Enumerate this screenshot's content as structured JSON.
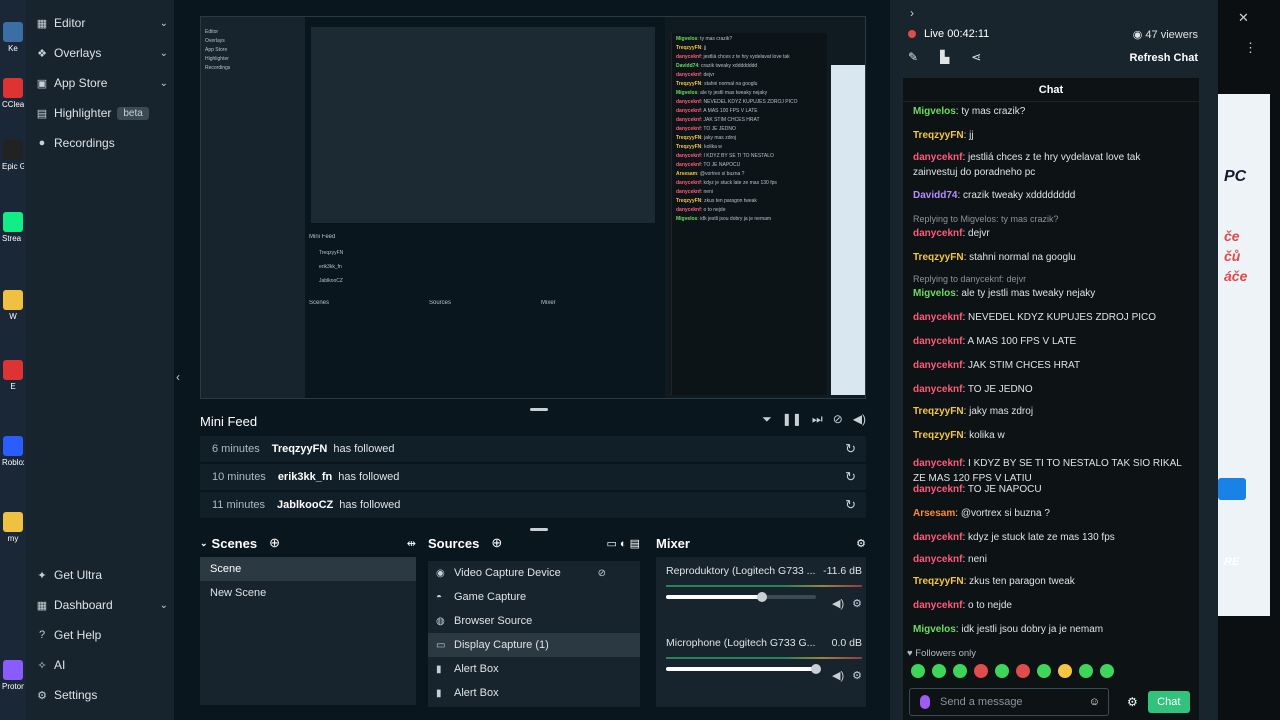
{
  "desktop": {
    "icons": [
      {
        "label": "Ke",
        "color": "#3a6ea5"
      },
      {
        "label": "CClea",
        "color": "#d33"
      },
      {
        "label": "Epic G Laun",
        "color": "#222"
      },
      {
        "label": "Strea Desk",
        "color": "#1e8"
      },
      {
        "label": "W",
        "color": "#f0c040"
      },
      {
        "label": "E",
        "color": "#d33"
      },
      {
        "label": "Roblox",
        "color": "#2a5cff"
      },
      {
        "label": "my",
        "color": "#f0c040"
      },
      {
        "label": "Proton",
        "color": "#8a5cff"
      }
    ]
  },
  "sidebar": {
    "items": [
      {
        "label": "Editor",
        "icon": "editor-icon",
        "chevron": true
      },
      {
        "label": "Overlays",
        "icon": "overlays-icon",
        "chevron": true
      },
      {
        "label": "App Store",
        "icon": "app-store-icon",
        "chevron": true
      },
      {
        "label": "Highlighter",
        "icon": "highlighter-icon",
        "badge": "beta"
      },
      {
        "label": "Recordings",
        "icon": "recordings-icon"
      }
    ],
    "bottom": [
      {
        "label": "Get Ultra",
        "icon": "ultra-icon"
      },
      {
        "label": "Dashboard",
        "icon": "dashboard-icon",
        "chevron": true
      },
      {
        "label": "Get Help",
        "icon": "help-icon"
      },
      {
        "label": "AI",
        "icon": "ai-icon"
      },
      {
        "label": "Settings",
        "icon": "settings-icon"
      }
    ]
  },
  "preview": {
    "chat_lines": [
      {
        "user": "Migvelos",
        "text": ": ty mas crazik?"
      },
      {
        "user": "TreqzyyFN",
        "text": ": jj"
      },
      {
        "user": "danyceknf",
        "text": ": jestliá chces z te hry vydelavat love tak"
      },
      {
        "user": "Davidd74",
        "text": ": crazik tweaky xdddddddd"
      },
      {
        "user": "danyceknf",
        "text": ": dejvr"
      },
      {
        "user": "TreqzyyFN",
        "text": ": stahni normal na googlu"
      },
      {
        "user": "Migvelos",
        "text": ": ale ty jestli mas tweaky nejaky"
      },
      {
        "user": "danyceknf",
        "text": ": NEVEDEL KDYZ KUPUJES ZDROJ PICO"
      },
      {
        "user": "danyceknf",
        "text": ": A MAS 100 FPS V LATE"
      },
      {
        "user": "danyceknf",
        "text": ": JAK STIM CHCES HRAT"
      },
      {
        "user": "danyceknf",
        "text": ": TO JE JEDNO"
      },
      {
        "user": "TreqzyyFN",
        "text": ": jaky mas zdroj"
      },
      {
        "user": "TreqzyyFN",
        "text": ": kolika w"
      },
      {
        "user": "danyceknf",
        "text": ": I KDYZ BY SE TI TO NESTALO"
      },
      {
        "user": "danyceknf",
        "text": ": TO JE NAPOCU"
      },
      {
        "user": "Arsesam",
        "text": ": @vortrex si buzna ?"
      },
      {
        "user": "danyceknf",
        "text": ": kdyz je stuck late ze mas 130 fps"
      },
      {
        "user": "danyceknf",
        "text": ": neni"
      },
      {
        "user": "TreqzyyFN",
        "text": ": zkus ten paragon tweak"
      },
      {
        "user": "danyceknf",
        "text": ": o to nejde"
      },
      {
        "user": "Migvelos",
        "text": ": idk jestli jsou dobry ja je nemam"
      }
    ]
  },
  "minifeed": {
    "title": "Mini Feed",
    "rows": [
      {
        "time": "6 minutes",
        "user": "TreqzyyFN",
        "action": "has followed"
      },
      {
        "time": "10 minutes",
        "user": "erik3kk_fn",
        "action": "has followed"
      },
      {
        "time": "11 minutes",
        "user": "JablkooCZ",
        "action": "has followed"
      }
    ]
  },
  "scenes": {
    "title": "Scenes",
    "items": [
      "Scene",
      "New Scene"
    ],
    "active_index": 0
  },
  "sources": {
    "title": "Sources",
    "items": [
      {
        "label": "Video Capture Device",
        "icon": "camera-icon"
      },
      {
        "label": "Game Capture",
        "icon": "gamepad-icon"
      },
      {
        "label": "Browser Source",
        "icon": "globe-icon"
      },
      {
        "label": "Display Capture (1)",
        "icon": "monitor-icon"
      },
      {
        "label": "Alert Box",
        "icon": "alert-icon"
      },
      {
        "label": "Alert Box",
        "icon": "alert-icon"
      }
    ],
    "active_index": 3
  },
  "mixer": {
    "title": "Mixer",
    "channels": [
      {
        "name": "Reproduktory (Logitech G733 ...",
        "level": "-11.6 dB",
        "volume": 0.64
      },
      {
        "name": "Microphone (Logitech G733 G...",
        "level": "0.0 dB",
        "volume": 1.0
      }
    ]
  },
  "chat": {
    "live_text": "Live 00:42:11",
    "viewers": "47 viewers",
    "refresh_label": "Refresh Chat",
    "header": "Chat",
    "messages": [
      {
        "user": "Migvelos",
        "color": "#6cdc5f",
        "text": ": ty mas crazik?"
      },
      {
        "user": "TreqzyyFN",
        "color": "#f5c643",
        "text": ": jj"
      },
      {
        "user": "danyceknf",
        "color": "#ff5a7a",
        "text": ": jestliá chces z te hry vydelavat love tak zainvestuj do poradneho pc"
      },
      {
        "user": "Davidd74",
        "color": "#b78cff",
        "text": ": crazik tweaky xdddddddd"
      },
      {
        "reply": "Replying to Migvelos: ty mas crazik?"
      },
      {
        "user": "danyceknf",
        "color": "#ff5a7a",
        "text": ": dejvr"
      },
      {
        "user": "TreqzyyFN",
        "color": "#f5c643",
        "text": ": stahni normal na googlu"
      },
      {
        "reply": "Replying to danyceknf: dejvr"
      },
      {
        "user": "Migvelos",
        "color": "#6cdc5f",
        "text": ": ale ty jestli mas tweaky nejaky"
      },
      {
        "user": "danyceknf",
        "color": "#ff5a7a",
        "text": ": NEVEDEL KDYZ KUPUJES ZDROJ PICO"
      },
      {
        "user": "danyceknf",
        "color": "#ff5a7a",
        "text": ": A MAS 100 FPS V LATE"
      },
      {
        "user": "danyceknf",
        "color": "#ff5a7a",
        "text": ": JAK STIM CHCES HRAT"
      },
      {
        "user": "danyceknf",
        "color": "#ff5a7a",
        "text": ": TO JE JEDNO"
      },
      {
        "user": "TreqzyyFN",
        "color": "#f5c643",
        "text": ": jaky mas zdroj"
      },
      {
        "user": "TreqzyyFN",
        "color": "#f5c643",
        "text": ": kolika w"
      },
      {
        "user": "danyceknf",
        "color": "#ff5a7a",
        "text": ": I KDYZ BY SE TI TO NESTALO TAK SIO RIKAL ZE MAS 120 FPS V LATIU"
      },
      {
        "user": "danyceknf",
        "color": "#ff5a7a",
        "text": ": TO JE NAPOCU"
      },
      {
        "user": "Arsesam",
        "color": "#ff8c2e",
        "text": ": @vortrex si buzna ?"
      },
      {
        "user": "danyceknf",
        "color": "#ff5a7a",
        "text": ": kdyz je stuck late ze mas 130 fps"
      },
      {
        "user": "danyceknf",
        "color": "#ff5a7a",
        "text": ": neni"
      },
      {
        "user": "TreqzyyFN",
        "color": "#f5c643",
        "text": ": zkus ten paragon tweak"
      },
      {
        "user": "danyceknf",
        "color": "#ff5a7a",
        "text": ": o to nejde"
      },
      {
        "user": "Migvelos",
        "color": "#6cdc5f",
        "text": ": idk jestli jsou dobry ja je nemam"
      }
    ],
    "followers_only": "Followers only",
    "send_placeholder": "Send a message",
    "chat_button": "Chat"
  },
  "browser_fragment": {
    "lines": [
      "PC",
      "če",
      "čů",
      "áče",
      "RE"
    ]
  }
}
